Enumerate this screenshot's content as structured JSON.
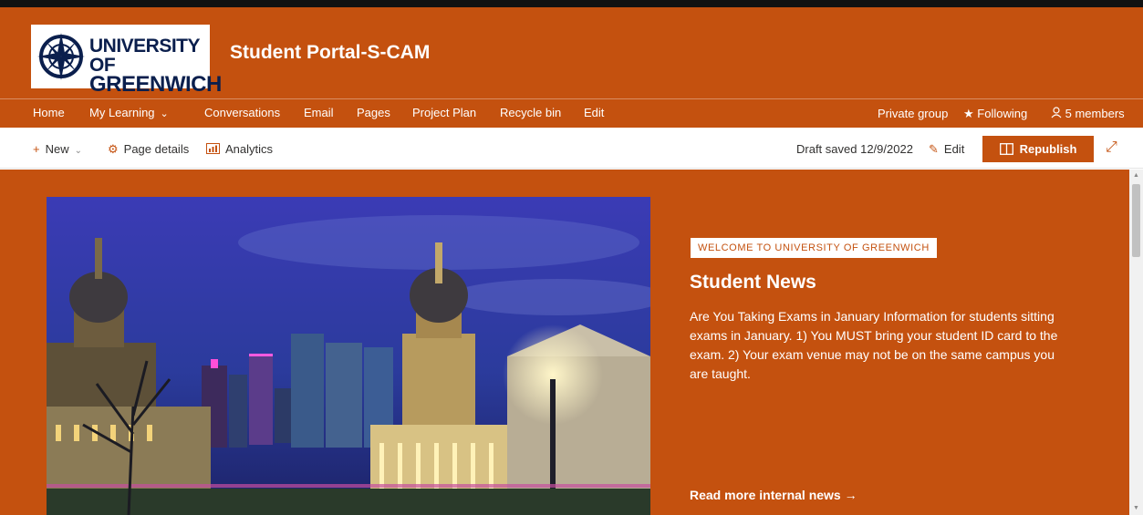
{
  "header": {
    "logo_line1": "UNIVERSITY OF",
    "logo_line2": "GREENWICH",
    "site_title": "Student Portal-S-CAM"
  },
  "nav": {
    "items": [
      "Home",
      "My Learning",
      "Conversations",
      "Email",
      "Pages",
      "Project Plan",
      "Recycle bin",
      "Edit"
    ],
    "privacy": "Private group",
    "following": "Following",
    "members": "5 members"
  },
  "command_bar": {
    "new_label": "New",
    "page_details_label": "Page details",
    "analytics_label": "Analytics",
    "draft_status": "Draft saved 12/9/2022",
    "edit_label": "Edit",
    "republish_label": "Republish"
  },
  "hero": {
    "tag": "WELCOME TO UNIVERSITY OF GREENWICH",
    "title": "Student News",
    "body": "Are You Taking Exams in January Information for students sitting exams in January. 1) You MUST bring your student ID card to the exam. 2) Your exam venue may not be on the same campus you are taught.",
    "read_more": "Read more internal news"
  },
  "colors": {
    "brand": "#c4510f",
    "text_dark": "#323130",
    "logo_navy": "#0b1f4d"
  },
  "icons": [
    "plus-icon",
    "chevron-down-icon",
    "gear-icon",
    "analytics-icon",
    "pencil-icon",
    "book-icon",
    "expand-icon",
    "star-icon",
    "person-icon",
    "arrow-right-icon"
  ]
}
